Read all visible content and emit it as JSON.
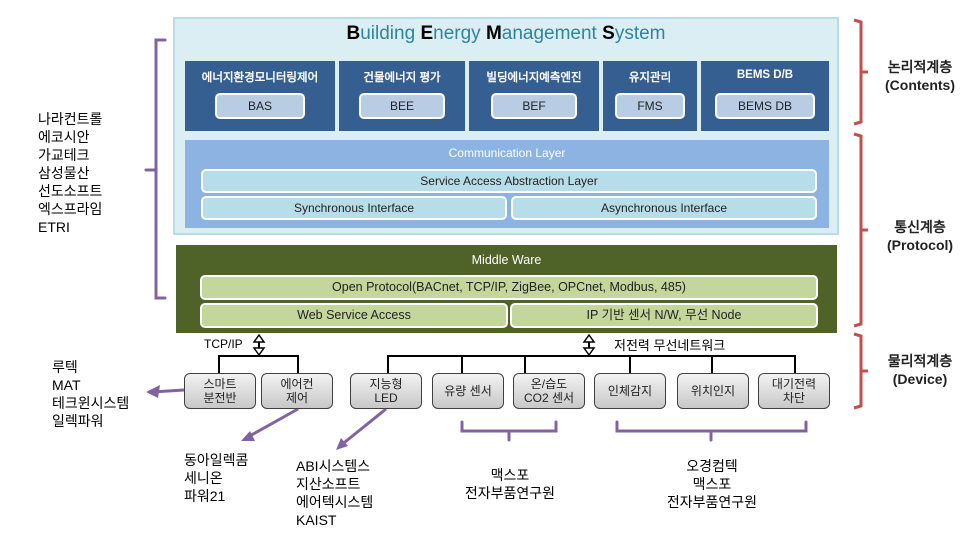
{
  "title": {
    "parts": [
      {
        "initial": "B",
        "rest": "uilding "
      },
      {
        "initial": "E",
        "rest": "nergy "
      },
      {
        "initial": "M",
        "rest": "anagement "
      },
      {
        "initial": "S",
        "rest": "ystem"
      }
    ]
  },
  "modules": [
    {
      "label": "에너지환경모니터링제어",
      "code": "BAS"
    },
    {
      "label": "건물에너지 평가",
      "code": "BEE"
    },
    {
      "label": "빌딩에너지예측엔진",
      "code": "BEF"
    },
    {
      "label": "유지관리",
      "code": "FMS"
    },
    {
      "label": "BEMS D/B",
      "code": "BEMS DB"
    }
  ],
  "communication": {
    "title": "Communication Layer",
    "service_access": "Service Access Abstraction Layer",
    "sync": "Synchronous Interface",
    "async": "Asynchronous Interface"
  },
  "middleware": {
    "title": "Middle Ware",
    "open_protocol": "Open Protocol(BACnet, TCP/IP, ZigBee, OPCnet,  Modbus, 485)",
    "web_service": "Web Service Access",
    "ip_sensor": "IP 기반 센서 N/W, 무선 Node"
  },
  "links": {
    "tcpip": "TCP/IP",
    "wireless": "저전력 무선네트워크"
  },
  "devices": [
    {
      "line1": "스마트",
      "line2": "분전반"
    },
    {
      "line1": "에어컨",
      "line2": "제어"
    },
    {
      "line1": "지능형",
      "line2": "LED"
    },
    {
      "line1": "유량 센서",
      "line2": ""
    },
    {
      "line1": "온/습도",
      "line2": "CO2 센서"
    },
    {
      "line1": "인체감지",
      "line2": ""
    },
    {
      "line1": "위치인지",
      "line2": ""
    },
    {
      "line1": "대기전력",
      "line2": "차단"
    }
  ],
  "layers": [
    {
      "name": "논리적계층",
      "sub": "(Contents)"
    },
    {
      "name": "통신계층",
      "sub": "(Protocol)"
    },
    {
      "name": "물리적계층",
      "sub": "(Device)"
    }
  ],
  "companies": {
    "software": [
      "나라컨트롤",
      "에코시안",
      "가교테크",
      "삼성물산",
      "선도소프트",
      "엑스프라임",
      "ETRI"
    ],
    "smart_panel": [
      "루텍",
      "MAT",
      "테크윈시스템",
      "일렉파워"
    ],
    "aircon": [
      "동아일렉콤",
      "세니온",
      "파워21"
    ],
    "led": [
      "ABI시스템스",
      "지산소프트",
      "에어텍시스템",
      "KAIST"
    ],
    "sensors_a": [
      "맥스포",
      "전자부품연구원"
    ],
    "sensors_b": [
      "오경컴텍",
      "맥스포",
      "전자부품연구원"
    ]
  },
  "colors": {
    "contents_bg": "#dbeef3",
    "module_bg": "#365f91",
    "comm_bg": "#8db3e2",
    "middleware_bg": "#4f6228",
    "bracket_purple": "#8064a2",
    "bracket_red": "#c0504d"
  }
}
